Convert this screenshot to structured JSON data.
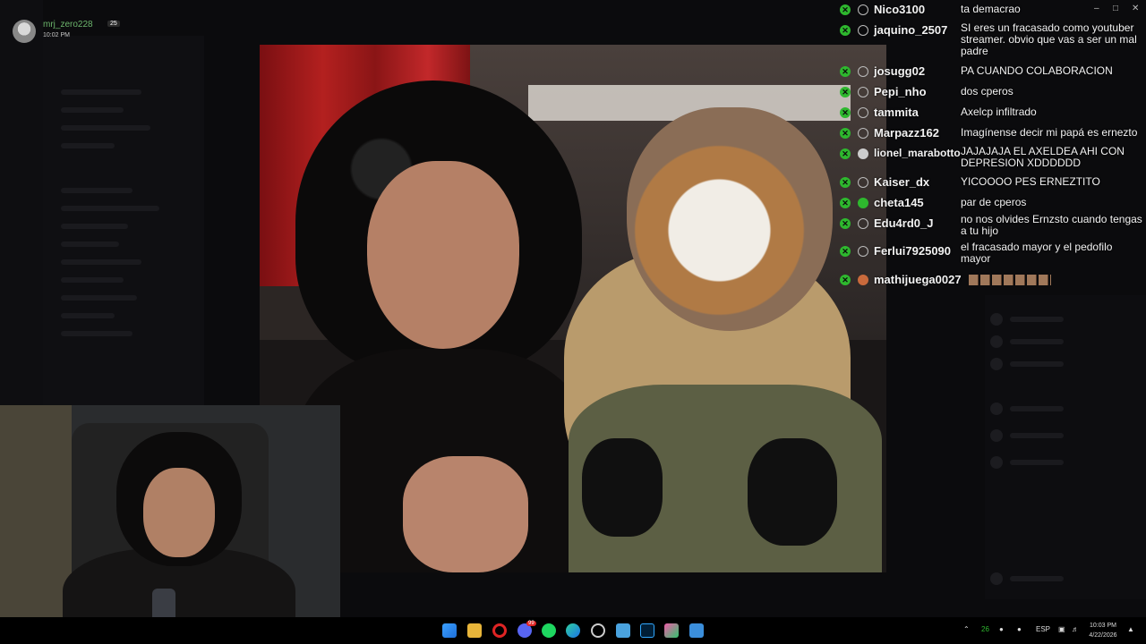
{
  "notification": {
    "username": "mrj_zero228",
    "badge": "25",
    "time": "10:02 PM"
  },
  "chat": {
    "messages": [
      {
        "user": "Nico3100",
        "text": "ta demacrao",
        "badge": "user-icon"
      },
      {
        "user": "jaquino_2507",
        "text": "SI eres un fracasado como youtuber streamer. obvio que vas a ser un mal padre",
        "badge": "user-icon"
      },
      {
        "user": "josugg02",
        "text": "PA CUANDO COLABORACION",
        "badge": "user-icon"
      },
      {
        "user": "Pepi_nho",
        "text": "dos cperos",
        "badge": "user-icon"
      },
      {
        "user": "tammita",
        "text": "Axelcp infiltrado",
        "badge": "user-icon"
      },
      {
        "user": "Marpazz162",
        "text": "Imagínense decir mi papá es ernezto",
        "badge": "user-icon"
      },
      {
        "user": "lionel_marabotto",
        "text": "JAJAJAJA EL AXELDEA AHI CON DEPRESION XDDDDDD",
        "badge": "ghost-icon"
      },
      {
        "user": "Kaiser_dx",
        "text": "YICOOOO PES ERNEZTITO",
        "badge": "user-icon"
      },
      {
        "user": "cheta145",
        "text": "par de cperos",
        "badge": "coin-icon"
      },
      {
        "user": "Edu4rd0_J",
        "text": "no nos olvides Ernzsto cuando tengas a tu hijo",
        "badge": "user-icon"
      },
      {
        "user": "Ferlui7925090",
        "text": "el fracasado mayor y el pedofilo mayor",
        "badge": "user-icon"
      },
      {
        "user": "mathijuega0027",
        "text": "",
        "badge": "avatar-icon"
      }
    ]
  },
  "taskbar": {
    "apps": [
      "windows-start-icon",
      "file-explorer-icon",
      "opera-icon",
      "discord-icon",
      "spotify-icon",
      "edge-icon",
      "settings-icon",
      "notepad-icon",
      "photoshop-icon",
      "game-icon",
      "app-icon"
    ],
    "discord_badge": "99",
    "language": "ESP",
    "time": "10:03 PM",
    "date": "4/22/2026",
    "tray_number": "26"
  },
  "colors": {
    "mod_badge": "#2eb82e",
    "curtain": "#b3201f",
    "notif_name": "#6cb56c"
  }
}
